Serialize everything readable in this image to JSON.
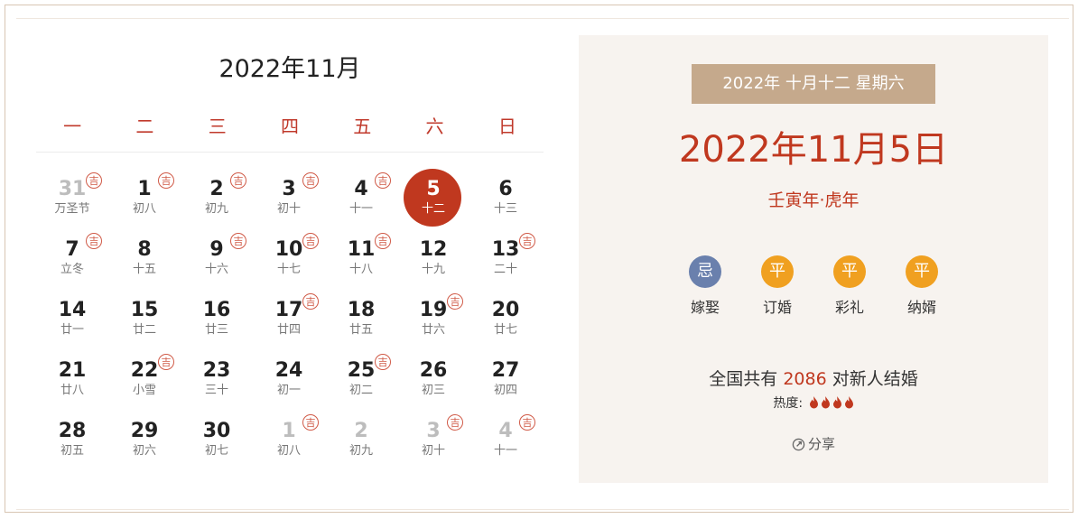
{
  "calendar": {
    "title": "2022年11月",
    "weekdays": [
      "一",
      "二",
      "三",
      "四",
      "五",
      "六",
      "日"
    ],
    "days": [
      {
        "num": "31",
        "lunar": "万圣节",
        "ji": true,
        "other": true
      },
      {
        "num": "1",
        "lunar": "初八",
        "ji": true
      },
      {
        "num": "2",
        "lunar": "初九",
        "ji": true
      },
      {
        "num": "3",
        "lunar": "初十",
        "ji": true
      },
      {
        "num": "4",
        "lunar": "十一",
        "ji": true
      },
      {
        "num": "5",
        "lunar": "十二",
        "selected": true
      },
      {
        "num": "6",
        "lunar": "十三"
      },
      {
        "num": "7",
        "lunar": "立冬",
        "ji": true
      },
      {
        "num": "8",
        "lunar": "十五"
      },
      {
        "num": "9",
        "lunar": "十六",
        "ji": true
      },
      {
        "num": "10",
        "lunar": "十七",
        "ji": true
      },
      {
        "num": "11",
        "lunar": "十八",
        "ji": true
      },
      {
        "num": "12",
        "lunar": "十九"
      },
      {
        "num": "13",
        "lunar": "二十",
        "ji": true
      },
      {
        "num": "14",
        "lunar": "廿一"
      },
      {
        "num": "15",
        "lunar": "廿二"
      },
      {
        "num": "16",
        "lunar": "廿三"
      },
      {
        "num": "17",
        "lunar": "廿四",
        "ji": true
      },
      {
        "num": "18",
        "lunar": "廿五"
      },
      {
        "num": "19",
        "lunar": "廿六",
        "ji": true
      },
      {
        "num": "20",
        "lunar": "廿七"
      },
      {
        "num": "21",
        "lunar": "廿八"
      },
      {
        "num": "22",
        "lunar": "小雪",
        "ji": true
      },
      {
        "num": "23",
        "lunar": "三十"
      },
      {
        "num": "24",
        "lunar": "初一"
      },
      {
        "num": "25",
        "lunar": "初二",
        "ji": true
      },
      {
        "num": "26",
        "lunar": "初三"
      },
      {
        "num": "27",
        "lunar": "初四"
      },
      {
        "num": "28",
        "lunar": "初五"
      },
      {
        "num": "29",
        "lunar": "初六"
      },
      {
        "num": "30",
        "lunar": "初七"
      },
      {
        "num": "1",
        "lunar": "初八",
        "ji": true,
        "other": true
      },
      {
        "num": "2",
        "lunar": "初九",
        "other": true
      },
      {
        "num": "3",
        "lunar": "初十",
        "ji": true,
        "other": true
      },
      {
        "num": "4",
        "lunar": "十一",
        "ji": true,
        "other": true
      }
    ],
    "ji_label": "吉"
  },
  "panel": {
    "date_badge": "2022年  十月十二  星期六",
    "big_date": "2022年11月5日",
    "ganzhi": "壬寅年·虎年",
    "omens": [
      {
        "badge": "忌",
        "label": "嫁娶",
        "color": "#6a80ad"
      },
      {
        "badge": "平",
        "label": "订婚",
        "color": "#f0a020"
      },
      {
        "badge": "平",
        "label": "彩礼",
        "color": "#f0a020"
      },
      {
        "badge": "平",
        "label": "纳婿",
        "color": "#f0a020"
      }
    ],
    "stats_prefix": "全国共有",
    "stats_count": "2086",
    "stats_suffix": "对新人结婚",
    "heat_label": "热度:",
    "heat_level": 4,
    "share_label": "分享",
    "accent_color": "#c0381f",
    "badge_color": "#c5a98c"
  }
}
